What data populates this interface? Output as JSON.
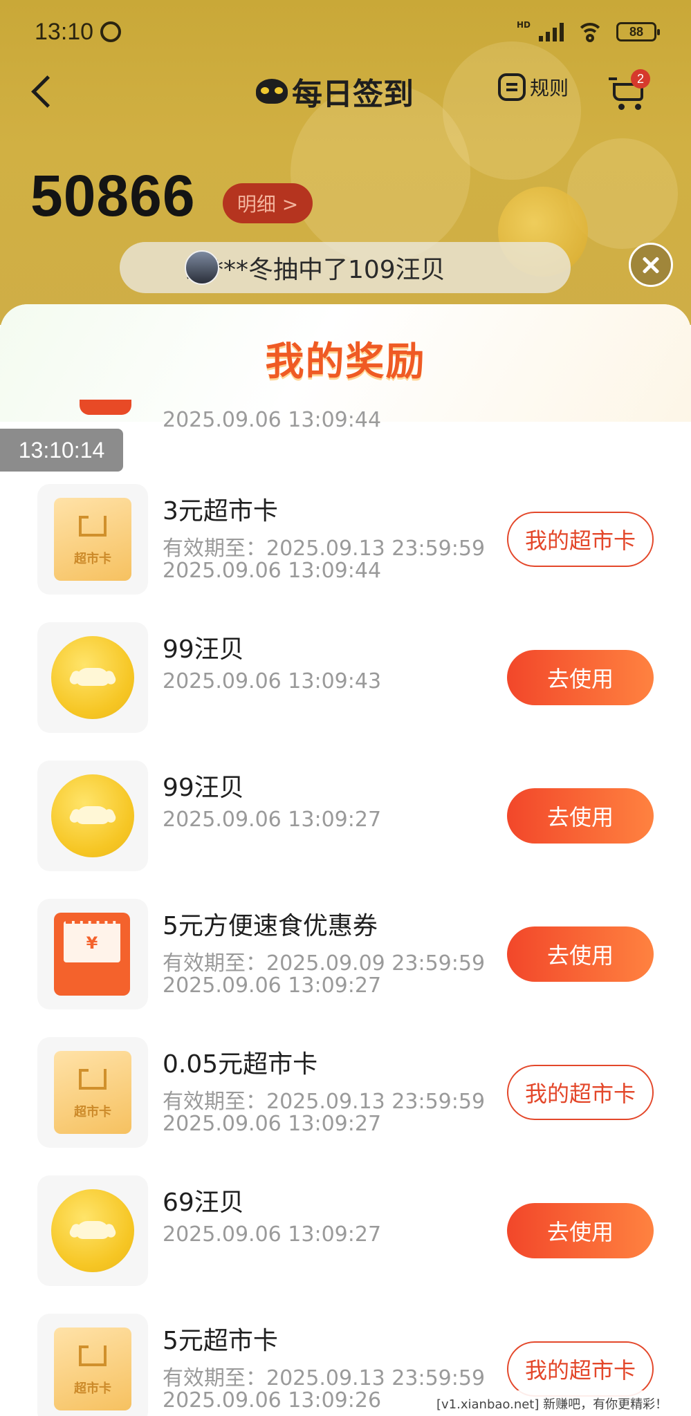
{
  "status_bar": {
    "time": "13:10",
    "network": "HD",
    "battery": "88"
  },
  "nav": {
    "title": "每日签到",
    "rules_label": "规则",
    "cart_badge": "2"
  },
  "points": {
    "value": "50866",
    "detail_label": "明细 >"
  },
  "ticker": {
    "text": "踏***冬抽中了109汪贝"
  },
  "panel": {
    "title": "我的奖励"
  },
  "partial_row": {
    "line": "2025.09.06 13:09:44"
  },
  "overlay_timestamp": "13:10:14",
  "rewards": [
    {
      "icon": "supermarket-card-icon",
      "title": "3元超市卡",
      "validity": "有效期至：2025.09.13 23:59:59",
      "time": "2025.09.06 13:09:44",
      "button": "我的超市卡",
      "button_type": "outline"
    },
    {
      "icon": "coin-icon",
      "title": "99汪贝",
      "validity": "",
      "time": "2025.09.06 13:09:43",
      "button": "去使用",
      "button_type": "filled"
    },
    {
      "icon": "coin-icon",
      "title": "99汪贝",
      "validity": "",
      "time": "2025.09.06 13:09:27",
      "button": "去使用",
      "button_type": "filled"
    },
    {
      "icon": "coupon-icon",
      "title": "5元方便速食优惠券",
      "validity": "有效期至：2025.09.09 23:59:59",
      "time": "2025.09.06 13:09:27",
      "button": "去使用",
      "button_type": "filled"
    },
    {
      "icon": "supermarket-card-icon",
      "title": "0.05元超市卡",
      "validity": "有效期至：2025.09.13 23:59:59",
      "time": "2025.09.06 13:09:27",
      "button": "我的超市卡",
      "button_type": "outline"
    },
    {
      "icon": "coin-icon",
      "title": "69汪贝",
      "validity": "",
      "time": "2025.09.06 13:09:27",
      "button": "去使用",
      "button_type": "filled"
    },
    {
      "icon": "supermarket-card-icon",
      "title": "5元超市卡",
      "validity": "有效期至：2025.09.13 23:59:59",
      "time": "2025.09.06 13:09:26",
      "button": "我的超市卡",
      "button_type": "outline"
    }
  ],
  "icon_labels": {
    "supermarket_card": "超市卡",
    "coupon_symbol": "¥"
  },
  "watermark": "[v1.xianbao.net] 新赚吧，有你更精彩！",
  "colors": {
    "header_bg": "#cfae46",
    "accent": "#f2472a",
    "title_orange": "#ef5a24"
  }
}
